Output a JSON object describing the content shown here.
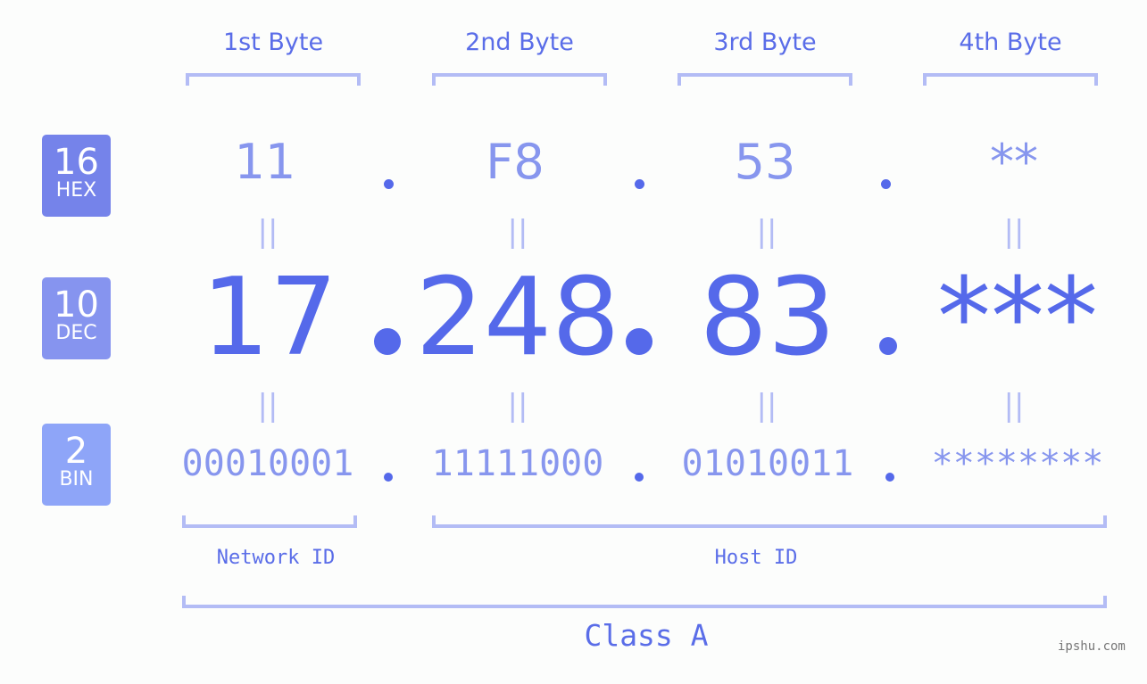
{
  "columns": [
    {
      "title": "1st Byte",
      "hex": "11",
      "dec": "17",
      "bin": "00010001"
    },
    {
      "title": "2nd Byte",
      "hex": "F8",
      "dec": "248",
      "bin": "11111000"
    },
    {
      "title": "3rd Byte",
      "hex": "53",
      "dec": "83",
      "bin": "01010011"
    },
    {
      "title": "4th Byte",
      "hex": "**",
      "dec": "***",
      "bin": "********"
    }
  ],
  "rows": {
    "hex": {
      "base": "16",
      "label": "HEX",
      "color": "#7583ea"
    },
    "dec": {
      "base": "10",
      "label": "DEC",
      "color": "#8694ef"
    },
    "bin": {
      "base": "2",
      "label": "BIN",
      "color": "#8ea5f8"
    }
  },
  "equals_sign": "||",
  "segments": {
    "network": "Network ID",
    "host": "Host ID",
    "class": "Class A"
  },
  "watermark": "ipshu.com",
  "colors": {
    "primary": "#5569ea",
    "light": "#8796ee",
    "bracket": "#b3bcf5"
  }
}
